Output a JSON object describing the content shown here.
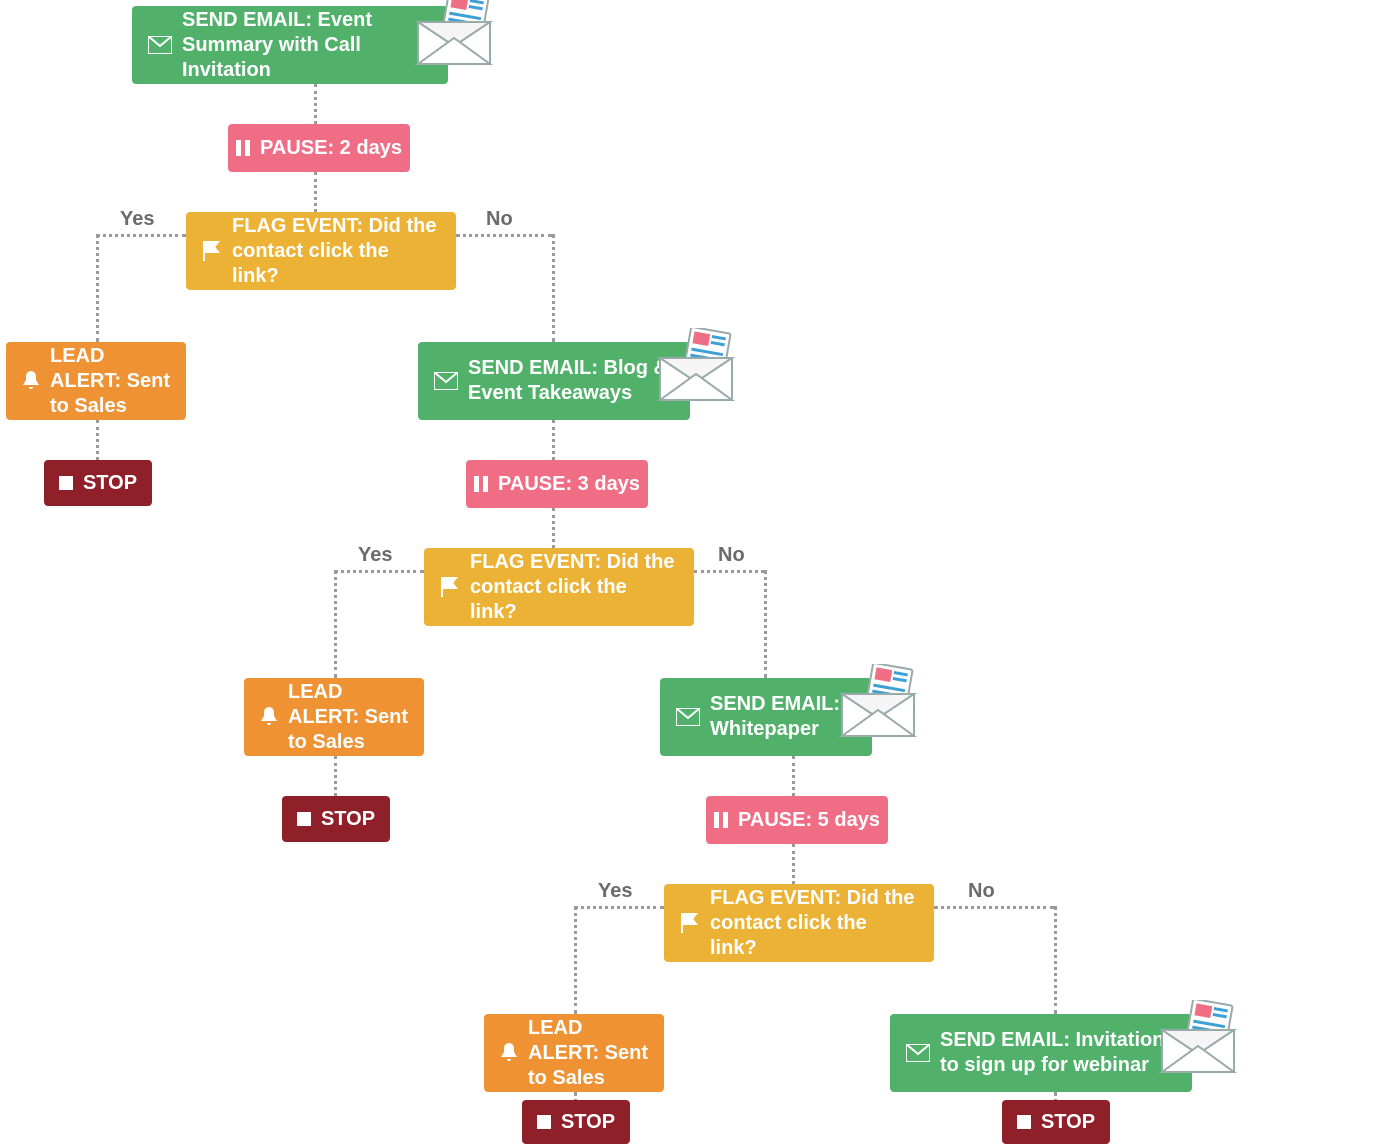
{
  "labels": {
    "yes": "Yes",
    "no": "No"
  },
  "nodes": {
    "email1": "SEND EMAIL: Event Summary with Call Invitation",
    "pause1": "PAUSE: 2 days",
    "flag1": "FLAG EVENT: Did the contact click the link?",
    "alert1": "LEAD ALERT: Sent to Sales",
    "stop1": "STOP",
    "email2": "SEND EMAIL: Blog & Event Takeaways",
    "pause2": "PAUSE: 3 days",
    "flag2": "FLAG EVENT: Did the contact click the link?",
    "alert2": "LEAD ALERT: Sent to Sales",
    "stop2": "STOP",
    "email3": "SEND EMAIL: Whitepaper",
    "pause3": "PAUSE: 5 days",
    "flag3": "FLAG EVENT: Did the contact click the link?",
    "alert3": "LEAD ALERT: Sent to Sales",
    "stop3": "STOP",
    "email4": "SEND EMAIL: Invitation to sign up for webinar",
    "stop4": "STOP"
  }
}
